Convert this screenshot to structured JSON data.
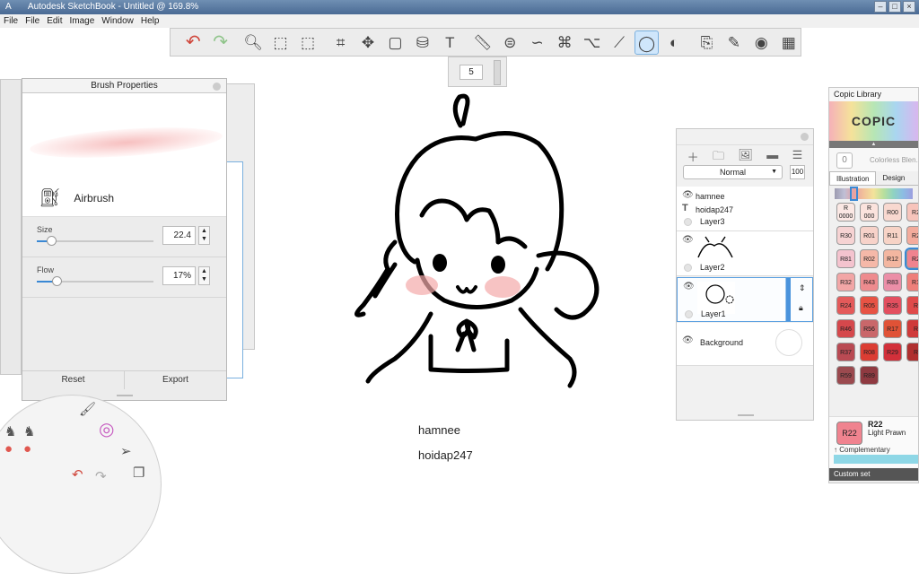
{
  "window": {
    "title": "Autodesk SketchBook - Untitled @ 169.8%",
    "app_letter": "A",
    "btns": [
      "–",
      "□",
      "×"
    ]
  },
  "menu": [
    "File",
    "File",
    "Edit",
    "Image",
    "Window",
    "Help"
  ],
  "toolbar": {
    "tools": [
      {
        "icon": "undo-icon",
        "glyph": "↶"
      },
      {
        "icon": "redo-icon",
        "glyph": "↷"
      },
      {
        "icon": "zoom-icon",
        "glyph": "🔍︎"
      },
      {
        "icon": "select-icon",
        "glyph": "⬚"
      },
      {
        "icon": "crop-selection-icon",
        "glyph": "⬚"
      },
      {
        "icon": "crop-icon",
        "glyph": "⌗"
      },
      {
        "icon": "transform-icon",
        "glyph": "✥"
      },
      {
        "icon": "distort-icon",
        "glyph": "▢"
      },
      {
        "icon": "fill-icon",
        "glyph": "⛁"
      },
      {
        "icon": "text-icon",
        "glyph": "T"
      },
      {
        "icon": "ruler-icon",
        "glyph": "📏︎"
      },
      {
        "icon": "ellipse-guide-icon",
        "glyph": "⊜"
      },
      {
        "icon": "french-curve-icon",
        "glyph": "∽"
      },
      {
        "icon": "perspective-icon",
        "glyph": "⌘"
      },
      {
        "icon": "symmetry-icon",
        "glyph": "⌥"
      },
      {
        "icon": "line-icon",
        "glyph": "⟋"
      },
      {
        "icon": "ellipse-icon",
        "glyph": "◯"
      },
      {
        "icon": "shape-icon",
        "glyph": "◐"
      },
      {
        "icon": "copy-paste-icon",
        "glyph": "⎘"
      },
      {
        "icon": "brush-library-icon",
        "glyph": "✎"
      },
      {
        "icon": "color-wheel-icon",
        "glyph": "◉"
      },
      {
        "icon": "swatches-icon",
        "glyph": "▦"
      }
    ]
  },
  "size_box": {
    "value": "5"
  },
  "brush_properties": {
    "title": "Brush Properties",
    "brush_name": "Airbrush",
    "size_label": "Size",
    "size_value": "22.4",
    "size_fraction": 0.12,
    "flow_label": "Flow",
    "flow_value": "17%",
    "flow_fraction": 0.17,
    "reset_label": "Reset",
    "export_label": "Export"
  },
  "canvas": {
    "text_line1": "hamnee",
    "text_line2": "hoidap247"
  },
  "layers": {
    "blend_mode": "Normal",
    "opacity": "100",
    "items": [
      {
        "name": "hamnee",
        "type": "text"
      },
      {
        "name": "hoidap247",
        "type": "text"
      },
      {
        "name": "Layer3"
      },
      {
        "name": "Layer2"
      },
      {
        "name": "Layer1"
      },
      {
        "name": "Background"
      }
    ]
  },
  "copic": {
    "title": "Copic Library",
    "logo": "COPIC",
    "colorless": "0",
    "colorless_name": "Colorless Blen...",
    "tab_illustration": "Illustration",
    "tab_design": "Design",
    "swatches": [
      [
        {
          "code": "R\n0000",
          "color": "#fbe8e4"
        },
        {
          "code": "R\n000",
          "color": "#fbe3dd"
        },
        {
          "code": "R00",
          "color": "#f8d8cf"
        },
        {
          "code": "R2",
          "color": "#f7c4bb"
        }
      ],
      [
        {
          "code": "R30",
          "color": "#f6d3d3"
        },
        {
          "code": "R01",
          "color": "#f7d2c9"
        },
        {
          "code": "R11",
          "color": "#f7d3c6"
        },
        {
          "code": "R2",
          "color": "#f3ab9c"
        }
      ],
      [
        {
          "code": "R81",
          "color": "#f4c3ce"
        },
        {
          "code": "R02",
          "color": "#f5b8a8"
        },
        {
          "code": "R12",
          "color": "#f3b6a0"
        },
        {
          "code": "R2",
          "color": "#f0838f"
        }
      ],
      [
        {
          "code": "R32",
          "color": "#f2a6a6"
        },
        {
          "code": "R43",
          "color": "#ee8b8e"
        },
        {
          "code": "R83",
          "color": "#eb8ea7"
        },
        {
          "code": "R1",
          "color": "#ee7f7a"
        }
      ],
      [
        {
          "code": "R24",
          "color": "#e45a5a"
        },
        {
          "code": "R05",
          "color": "#e75344"
        },
        {
          "code": "R35",
          "color": "#e34f5f"
        },
        {
          "code": "R",
          "color": "#df4a4a"
        }
      ],
      [
        {
          "code": "R46",
          "color": "#d5484c"
        },
        {
          "code": "R56",
          "color": "#c9676a"
        },
        {
          "code": "R17",
          "color": "#e05236"
        },
        {
          "code": "R",
          "color": "#cf3a3a"
        }
      ],
      [
        {
          "code": "R37",
          "color": "#b94a53"
        },
        {
          "code": "R08",
          "color": "#db3d33"
        },
        {
          "code": "R29",
          "color": "#d2303a"
        },
        {
          "code": "R",
          "color": "#b03030"
        }
      ],
      [
        {
          "code": "R59",
          "color": "#9b4a4f"
        },
        {
          "code": "R89",
          "color": "#8f3a41"
        }
      ]
    ],
    "current_code": "R22",
    "current_name": "Light Prawn",
    "complementary": "↑ Complementary",
    "custom_set": "Custom set"
  },
  "colors": {
    "accent": "#3a88d4",
    "current_swatch": "#f0838f"
  }
}
